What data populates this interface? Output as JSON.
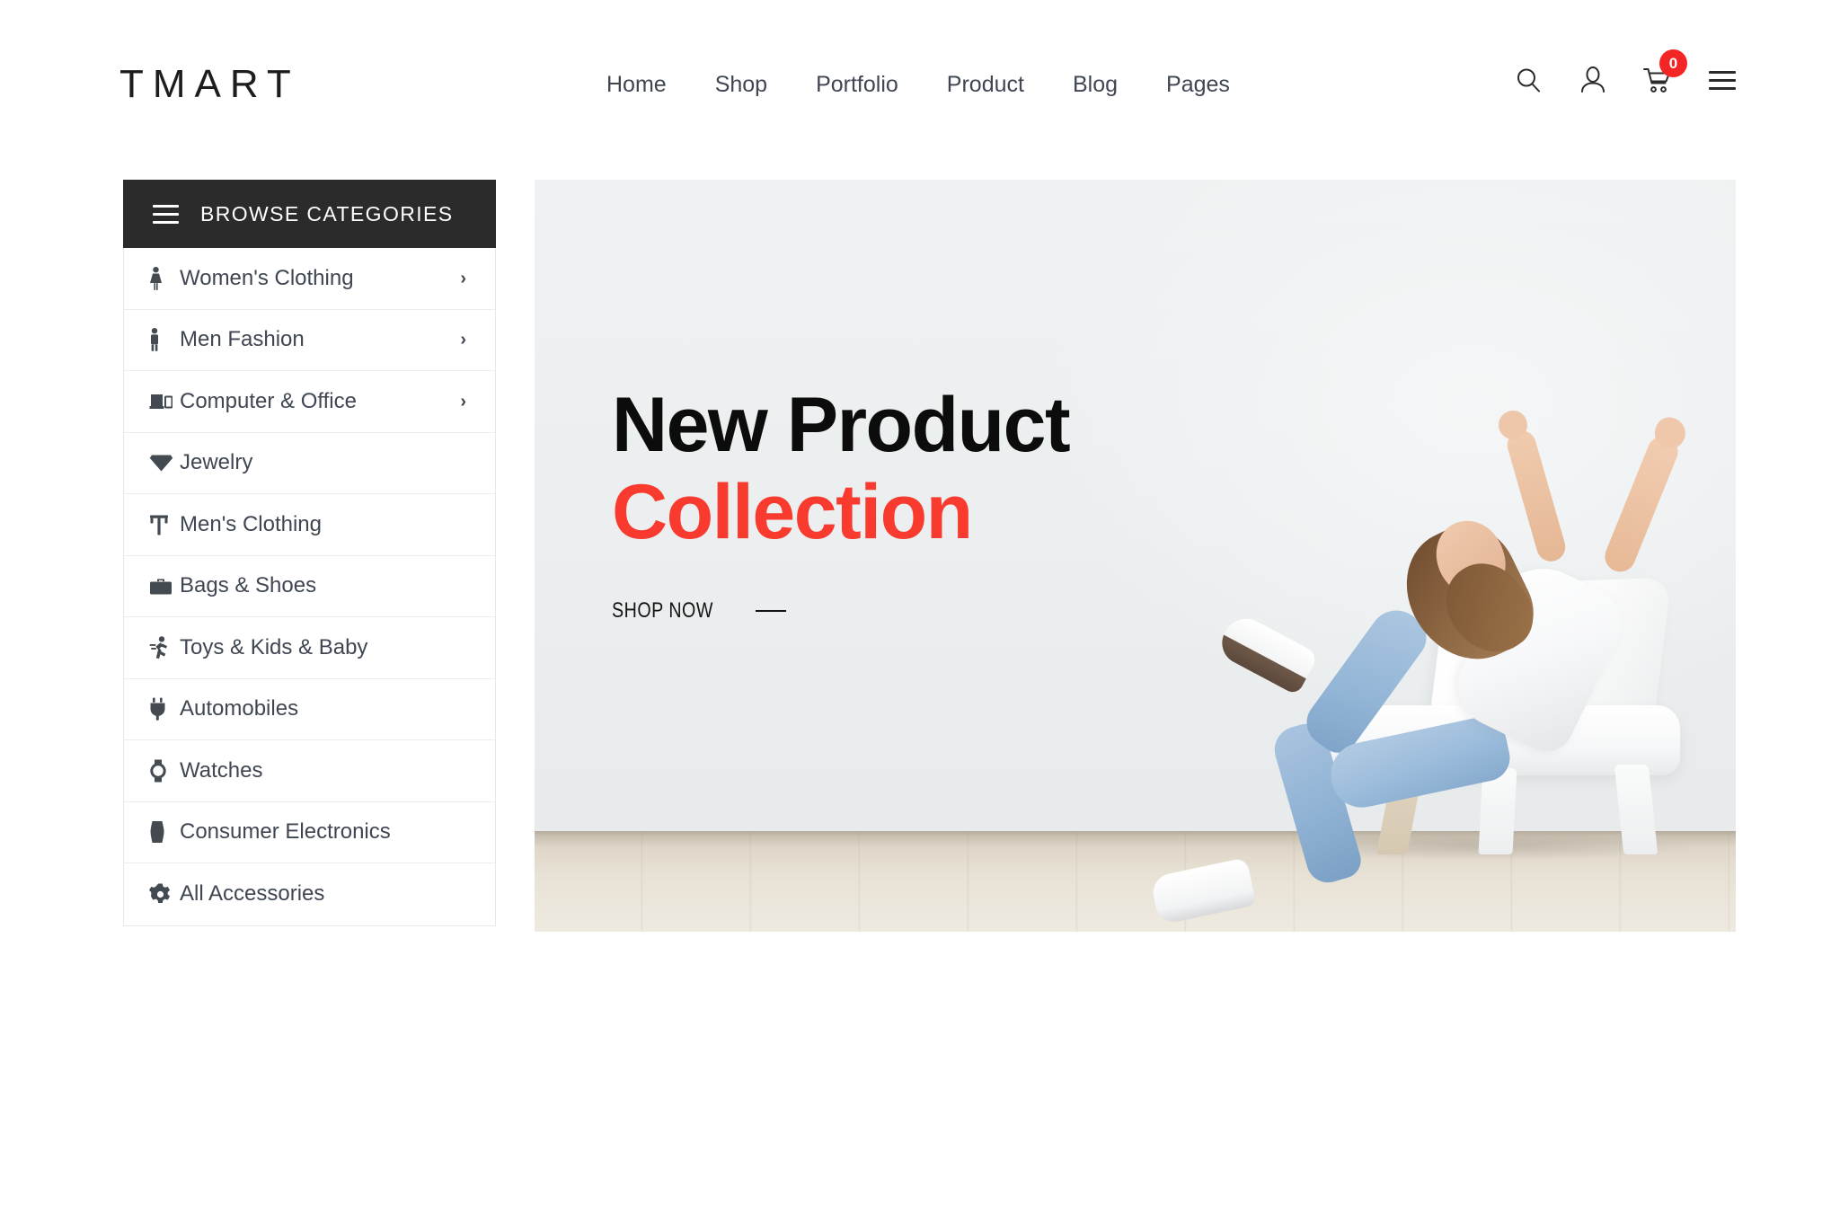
{
  "brand": {
    "logo": "TMART",
    "accent_color": "#f93a2f",
    "dark_color": "#2b2b2b"
  },
  "header": {
    "nav": [
      {
        "label": "Home"
      },
      {
        "label": "Shop"
      },
      {
        "label": "Portfolio"
      },
      {
        "label": "Product"
      },
      {
        "label": "Blog"
      },
      {
        "label": "Pages"
      }
    ],
    "icons": {
      "search": "search-icon",
      "account": "user-icon",
      "cart": "cart-icon",
      "menu": "hamburger-icon"
    },
    "cart_count": "0"
  },
  "sidebar": {
    "title": "BROWSE CATEGORIES",
    "items": [
      {
        "label": "Women's Clothing",
        "icon": "female-icon",
        "has_arrow": true
      },
      {
        "label": "Men Fashion",
        "icon": "male-icon",
        "has_arrow": true
      },
      {
        "label": "Computer & Office",
        "icon": "laptop-icon",
        "has_arrow": true
      },
      {
        "label": "Jewelry",
        "icon": "diamond-icon",
        "has_arrow": false
      },
      {
        "label": "Men's Clothing",
        "icon": "shirt-icon",
        "has_arrow": false
      },
      {
        "label": "Bags & Shoes",
        "icon": "briefcase-icon",
        "has_arrow": false
      },
      {
        "label": "Toys & Kids & Baby",
        "icon": "running-child-icon",
        "has_arrow": false
      },
      {
        "label": "Automobiles",
        "icon": "plug-icon",
        "has_arrow": false
      },
      {
        "label": "Watches",
        "icon": "watch-icon",
        "has_arrow": false
      },
      {
        "label": "Consumer Electronics",
        "icon": "device-icon",
        "has_arrow": false
      },
      {
        "label": "All Accessories",
        "icon": "gear-icon",
        "has_arrow": false
      }
    ],
    "arrow_glyph": "›"
  },
  "hero": {
    "title_line1": "New Product",
    "title_line2": "Collection",
    "cta_label": "SHOP NOW",
    "background_color": "#eef0f1"
  }
}
